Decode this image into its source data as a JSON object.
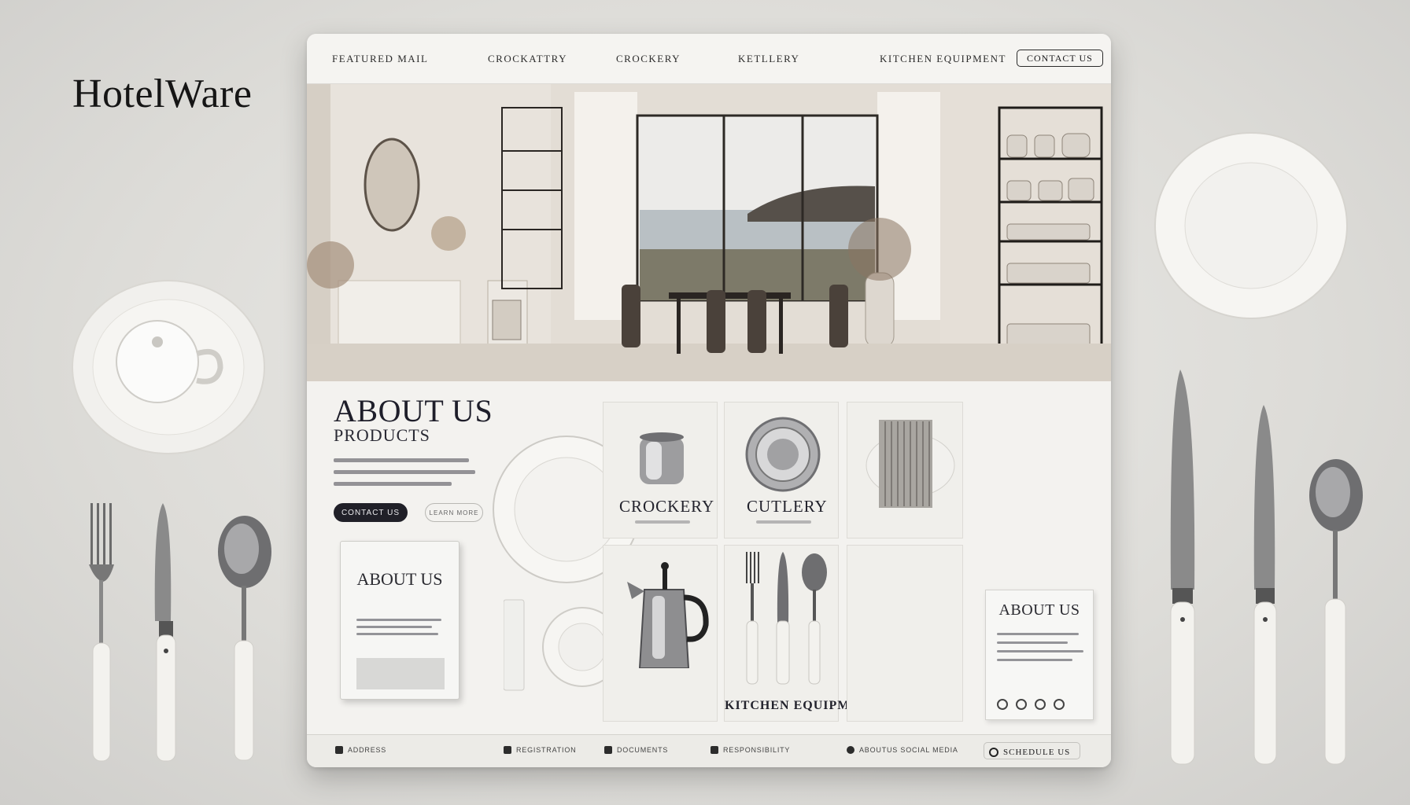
{
  "brand": {
    "name": "HotelWare"
  },
  "nav": {
    "items": [
      "FEATURED MAIL",
      "CROCKATTRY",
      "CROCKERY",
      "KETLLERY",
      "KITCHEN EQUIPMENT"
    ],
    "contact_button": "CONTACT US"
  },
  "content": {
    "heading": "ABOUT US",
    "subheading": "PRODUCTS",
    "primary_button": "CONTACT US",
    "secondary_button": "LEARN MORE",
    "book_title": "ABOUT US"
  },
  "tiles": {
    "crockery": "CROCKERY",
    "cutlery": "CUTLERY",
    "kitchen_equipment": "KITCHEN EQUIPMENT",
    "about_card_title": "ABOUT US"
  },
  "footer": {
    "items": [
      "ADDRESS",
      "REGISTRATION",
      "DOCUMENTS",
      "RESPONSIBILITY",
      "ABOUTUS SOCIAL MEDIA"
    ],
    "button": "SCHEDULE US"
  },
  "colors": {
    "background": "#dddcd8",
    "card": "#f3f2ef",
    "ink": "#1b1b1d",
    "button_dark": "#202028"
  }
}
